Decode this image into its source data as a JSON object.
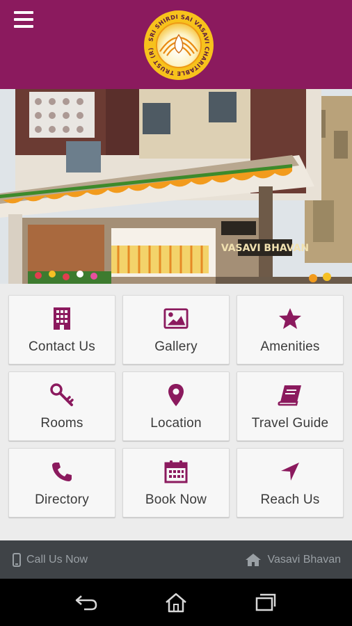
{
  "colors": {
    "brand": "#8b1a5e",
    "icon": "#8b1a5e",
    "tile_bg": "#f7f7f7",
    "bottom_bar": "#3f4347",
    "bottom_text": "#9aa0a5"
  },
  "header": {
    "menu_icon": "hamburger-menu-icon",
    "logo_text": "SRI SHIRDI SAI VASAVI CHARITABLE TRUST (R)"
  },
  "hero": {
    "signage": "VASAVI BHAVAN"
  },
  "menu": [
    {
      "label": "Contact Us",
      "icon": "building-icon"
    },
    {
      "label": "Gallery",
      "icon": "image-icon"
    },
    {
      "label": "Amenities",
      "icon": "star-icon"
    },
    {
      "label": "Rooms",
      "icon": "key-icon"
    },
    {
      "label": "Location",
      "icon": "map-pin-icon"
    },
    {
      "label": "Travel Guide",
      "icon": "book-icon"
    },
    {
      "label": "Directory",
      "icon": "phone-icon"
    },
    {
      "label": "Book Now",
      "icon": "calendar-icon"
    },
    {
      "label": "Reach Us",
      "icon": "navigation-arrow-icon"
    }
  ],
  "bottom_bar": {
    "call_label": "Call Us Now",
    "call_icon": "mobile-phone-icon",
    "home_label": "Vasavi Bhavan",
    "home_icon": "home-icon"
  },
  "system_nav": {
    "back": "back-icon",
    "home": "home-outline-icon",
    "recents": "recents-icon"
  }
}
